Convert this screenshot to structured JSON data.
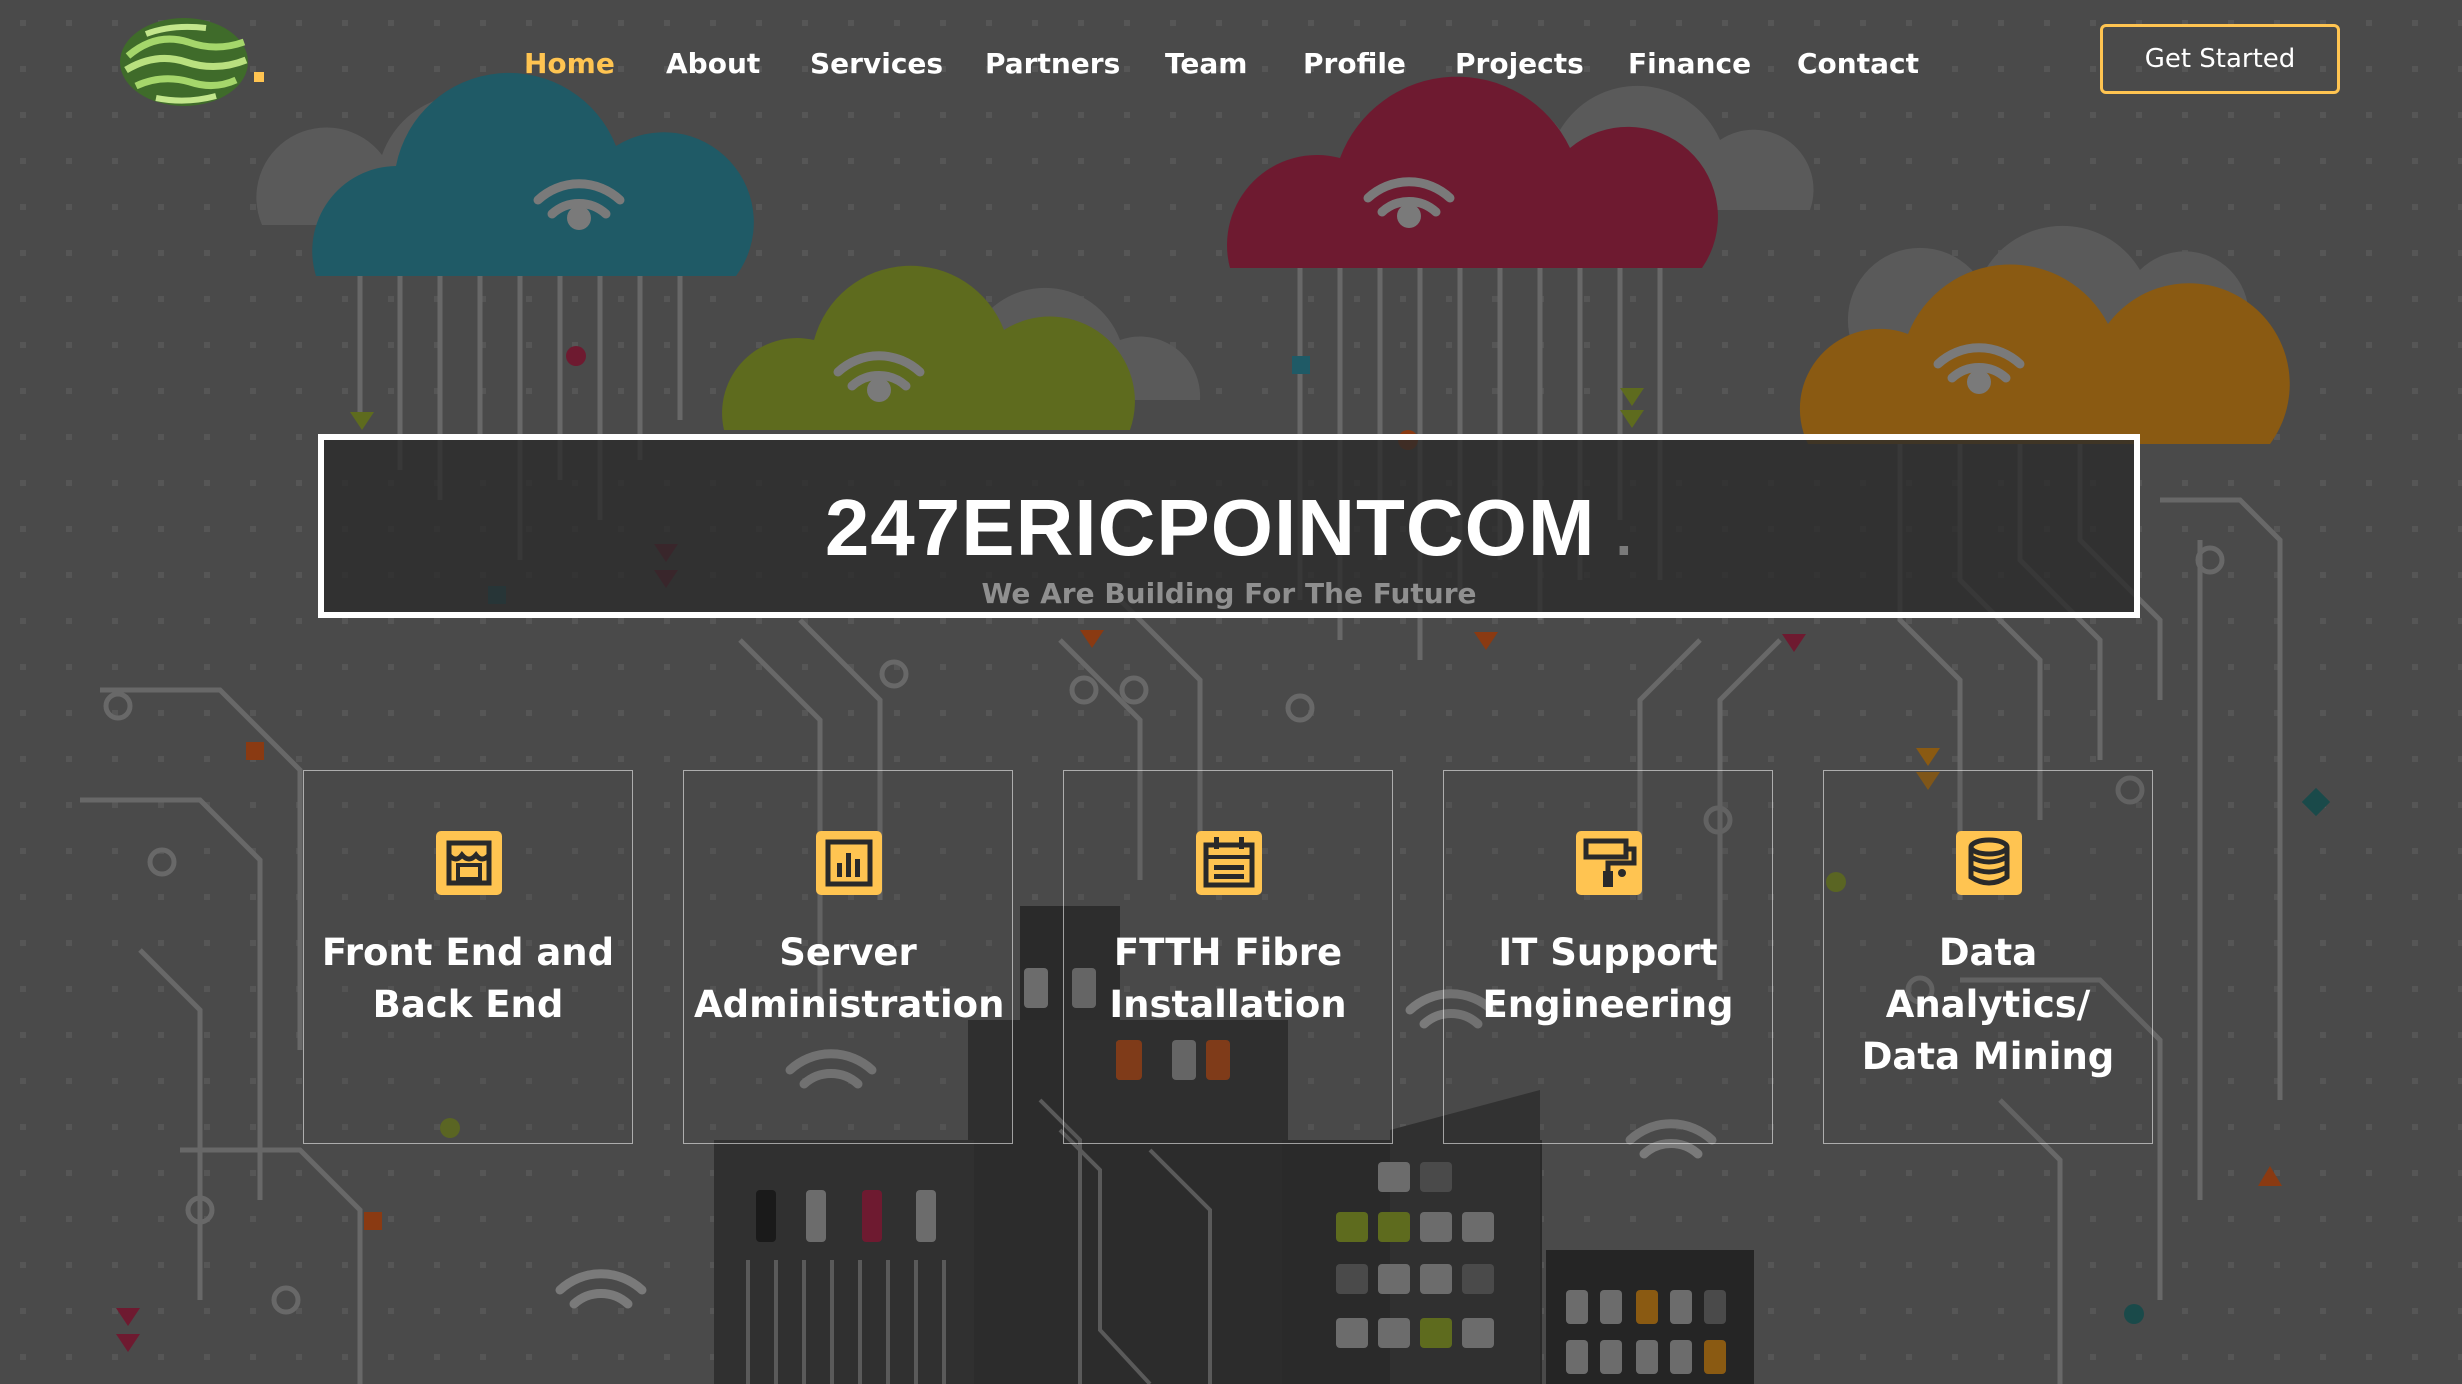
{
  "brand": {
    "logo_alt": "247ERICPOINTCOM logo"
  },
  "nav": {
    "items": [
      {
        "label": "Home",
        "active": true
      },
      {
        "label": "About",
        "active": false
      },
      {
        "label": "Services",
        "active": false
      },
      {
        "label": "Partners",
        "active": false
      },
      {
        "label": "Team",
        "active": false
      },
      {
        "label": "Profile",
        "active": false
      },
      {
        "label": "Projects",
        "active": false
      },
      {
        "label": "Finance",
        "active": false
      },
      {
        "label": "Contact",
        "active": false
      }
    ],
    "cta_label": "Get Started"
  },
  "hero": {
    "title": "247ERICPOINTCOM",
    "title_dot": ".",
    "subtitle": "We Are Building For The Future"
  },
  "services": [
    {
      "title": "Front End and Back End",
      "icon": "store-icon"
    },
    {
      "title": "Server Administration",
      "icon": "bar-chart-icon"
    },
    {
      "title": "FTTH Fibre Installation",
      "icon": "calendar-icon"
    },
    {
      "title": "IT Support Engineering",
      "icon": "paint-roller-icon"
    },
    {
      "title": "Data Analytics/ Data Mining",
      "icon": "database-icon"
    }
  ],
  "colors": {
    "accent": "#ffc451",
    "page_bg": "#4a4a4a",
    "cloud_teal": "#1f5a66",
    "cloud_crimson": "#6e1a30",
    "cloud_olive": "#5e6b1e",
    "cloud_orange": "#8a5a12"
  }
}
